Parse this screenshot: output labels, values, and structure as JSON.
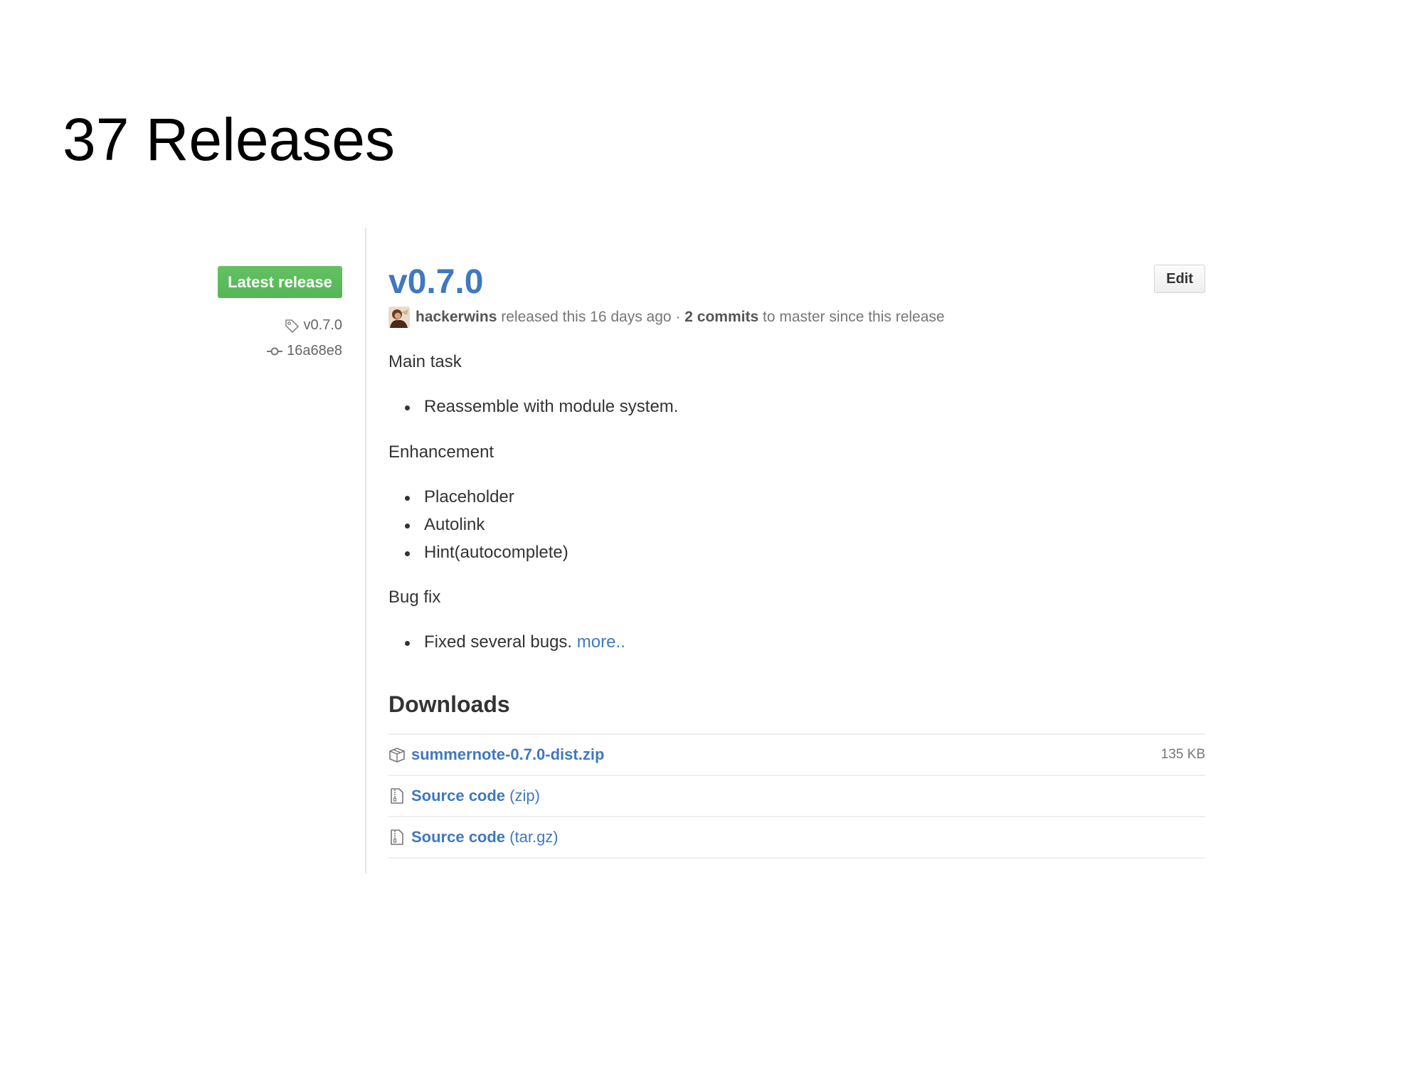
{
  "page": {
    "title": "37 Releases"
  },
  "release": {
    "badge": "Latest release",
    "tag": "v0.7.0",
    "commit": "16a68e8",
    "title": "v0.7.0",
    "edit_label": "Edit",
    "author": "hackerwins",
    "released_text": "released this 16 days ago",
    "separator": "·",
    "commits_label": "2 commits",
    "commits_suffix": "to master since this release"
  },
  "notes": {
    "sections": [
      {
        "heading": "Main task",
        "items": [
          "Reassemble with module system."
        ]
      },
      {
        "heading": "Enhancement",
        "items": [
          "Placeholder",
          "Autolink",
          "Hint(autocomplete)"
        ]
      },
      {
        "heading": "Bug fix",
        "items": [
          "Fixed several bugs."
        ]
      }
    ],
    "more_link": "more.."
  },
  "downloads": {
    "heading": "Downloads",
    "files": [
      {
        "name": "summernote-0.7.0-dist.zip",
        "suffix": "",
        "size": "135 KB",
        "icon": "package-icon"
      },
      {
        "name": "Source code",
        "suffix": "(zip)",
        "size": "",
        "icon": "file-zip-icon"
      },
      {
        "name": "Source code",
        "suffix": "(tar.gz)",
        "size": "",
        "icon": "file-zip-icon"
      }
    ]
  },
  "colors": {
    "link": "#4078c0",
    "badge": "#5cb85c",
    "muted": "#767676",
    "divider": "#e5e5e5"
  }
}
